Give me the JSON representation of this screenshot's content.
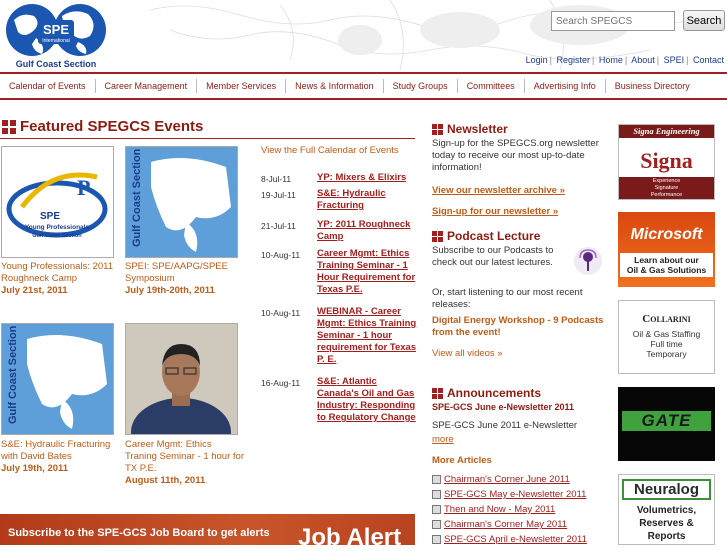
{
  "header": {
    "logo_text": "SPE",
    "logo_subtext": "International",
    "logo_caption": "Gulf Coast Section",
    "search": {
      "placeholder": "Search SPEGCS",
      "button_label": "Search"
    },
    "top_links": [
      "Login",
      "Register",
      "Home",
      "About",
      "SPEI",
      "Contact"
    ]
  },
  "nav": {
    "items": [
      "Calendar of Events",
      "Career Management",
      "Member Services",
      "News & Information",
      "Study Groups",
      "Committees",
      "Advertising Info",
      "Business Directory"
    ]
  },
  "featured": {
    "title": "Featured SPEGCS Events",
    "events": [
      {
        "caption": "Young Professionals: 2011 Roughneck Camp",
        "date": "July 21st, 2011",
        "thumb_text": "Young Professionals",
        "thumb_sub": "Gulf Coast Section"
      },
      {
        "caption": "SPEI: SPE/AAPG/SPEE Symposium",
        "date": "July 19th-20th, 2011",
        "thumb_text": "Gulf Coast Section"
      },
      {
        "caption": "S&E: Hydraulic Fracturing with David Bates",
        "date": "July 19th, 2011",
        "thumb_text": "Gulf Coast Section"
      },
      {
        "caption": "Career Mgmt: Ethics Traning Seminar - 1 hour for TX P.E.",
        "date": "August 11th, 2011"
      }
    ],
    "view_calendar": "View the Full Calendar of Events",
    "calendar": [
      {
        "date": "8-Jul-11",
        "title": "YP: Mixers & Elixirs"
      },
      {
        "date": "19-Jul-11",
        "title": "S&E: Hydraulic Fracturing"
      },
      {
        "date": "21-Jul-11",
        "title": "YP: 2011 Roughneck Camp"
      },
      {
        "date": "10-Aug-11",
        "title": "Career Mgmt: Ethics Training Seminar - 1 Hour Requirement for Texas P.E."
      },
      {
        "date": "10-Aug-11",
        "title": "WEBINAR - Career Mgmt: Ethics Training Seminar - 1 hour requirement for Texas P. E."
      },
      {
        "date": "16-Aug-11",
        "title": "S&E: Atlantic Canada's Oil and Gas Industry: Responding to Regulatory Change"
      }
    ],
    "banner_text": "Subscribe to the SPE-GCS Job Board to get alerts",
    "banner_big": "Job Alert"
  },
  "newsletter": {
    "title": "Newsletter",
    "text": "Sign-up for the SPEGCS.org newsletter today to receive our most up-to-date information!",
    "archive_link": "View our newsletter archive »",
    "signup_link": "Sign-up for our newsletter »"
  },
  "podcast": {
    "title": "Podcast Lecture",
    "text": "Subscribe to our Podcasts to check out our latest lectures.",
    "text2": "Or, start listening to our most recent releases:",
    "workshop_link": "Digital Energy Workshop - 9 Podcasts from the event!",
    "videos_link": "View all videos »"
  },
  "announcements": {
    "title": "Announcements",
    "headline": "SPE-GCS June e-Newsletter 2011",
    "text": "SPE-GCS June 2011 e-Newsletter",
    "more": "more",
    "more_articles": "More Articles",
    "articles": [
      "Chairman's Corner June 2011",
      "SPE-GCS May e-Newsletter 2011",
      "Then and Now - May 2011",
      "Chairman's Corner May 2011",
      "SPE-GCS April e-Newsletter 2011"
    ]
  },
  "ads": {
    "signa": {
      "top": "Signa Engineering",
      "logo": "Signa",
      "tag1": "Experience",
      "tag2": "Signature",
      "tag3": "Performance"
    },
    "microsoft": {
      "logo": "Microsoft",
      "line1": "Learn about our",
      "line2": "Oil & Gas Solutions"
    },
    "collarini": {
      "logo": "Collarini",
      "line1": "Oil & Gas Staffing",
      "line2": "Full time",
      "line3": "Temporary"
    },
    "gate": {
      "logo": "GATE"
    },
    "neuralog": {
      "logo": "Neuralog",
      "line1": "Volumetrics,",
      "line2": "Reserves & Reports"
    }
  }
}
